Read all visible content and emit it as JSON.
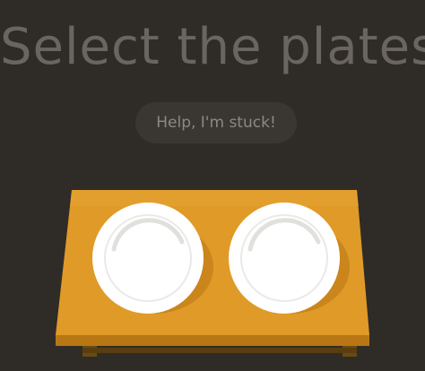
{
  "game": {
    "title": "Select the plates",
    "help_button_label": "Help, I'm stuck!",
    "colors": {
      "background": "#2f2b27",
      "title_text": "#6a6560",
      "table_top": "#e09a27",
      "table_front": "#bb7a16",
      "table_legs": "#6a4a14",
      "plate": "#ffffff",
      "plate_rim_shadow": "#e6e4e1",
      "plate_shadow": "#b77514"
    }
  },
  "table": {
    "items": [
      {
        "type": "plate",
        "label": "plate"
      },
      {
        "type": "plate",
        "label": "plate"
      }
    ]
  }
}
